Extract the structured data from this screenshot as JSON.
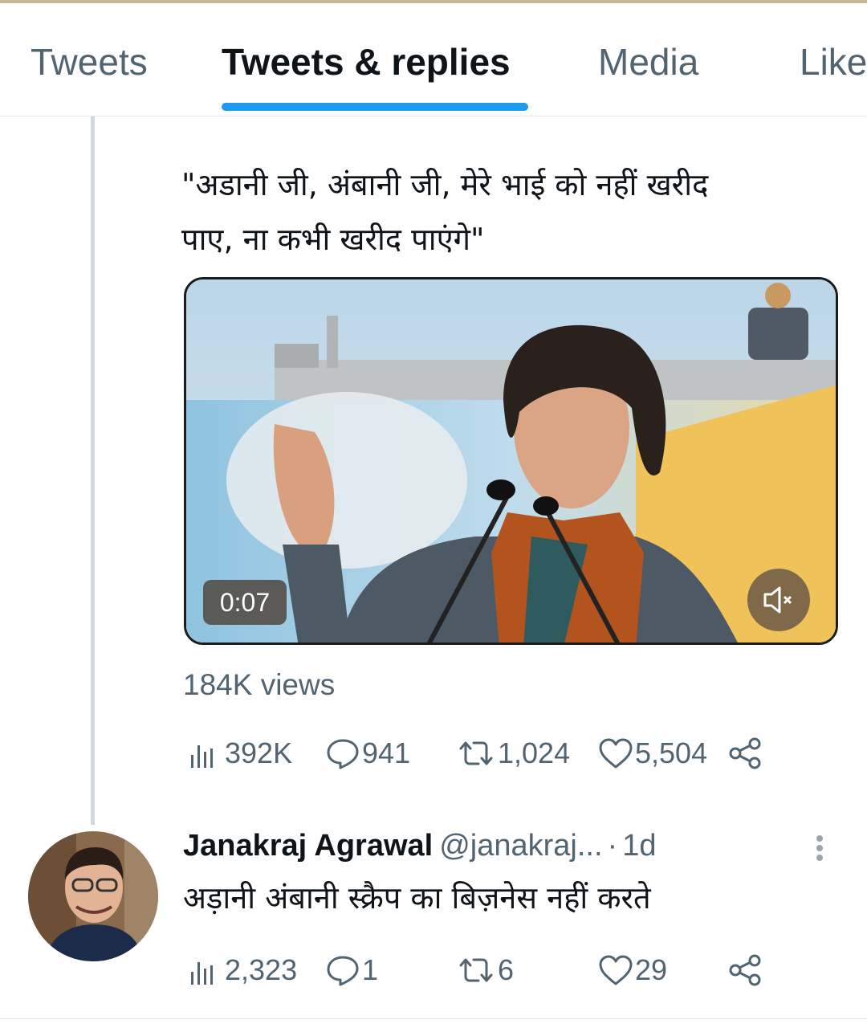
{
  "tabs": [
    {
      "label": "Tweets",
      "active": false
    },
    {
      "label": "Tweets & replies",
      "active": true
    },
    {
      "label": "Media",
      "active": false
    },
    {
      "label": "Like",
      "active": false
    }
  ],
  "tweet": {
    "text_line1": "\"अडानी जी, अंबानी जी, मेरे भाई को नहीं खरीद",
    "text_line2": "पाए, ना कभी खरीद पाएंगे\"",
    "video_duration": "0:07",
    "views_label": "184K views",
    "stats": {
      "views": "392K",
      "replies": "941",
      "retweets": "1,024",
      "likes": "5,504"
    }
  },
  "reply": {
    "name": "Janakraj Agrawal",
    "handle": "@janakraj...",
    "separator": "·",
    "time": "1d",
    "text": "अड़ानी अंबानी स्क्रैप का बिज़नेस नहीं करते",
    "stats": {
      "views": "2,323",
      "replies": "1",
      "retweets": "6",
      "likes": "29"
    }
  },
  "colors": {
    "accent": "#1d9bf0",
    "secondary_text": "#536471",
    "primary_text": "#0f1419"
  },
  "icons": {
    "views": "bar-chart-icon",
    "reply": "speech-bubble-icon",
    "retweet": "retweet-arrows-icon",
    "like": "heart-icon",
    "share": "share-nodes-icon",
    "more": "vertical-dots-icon",
    "mute": "speaker-muted-icon"
  }
}
